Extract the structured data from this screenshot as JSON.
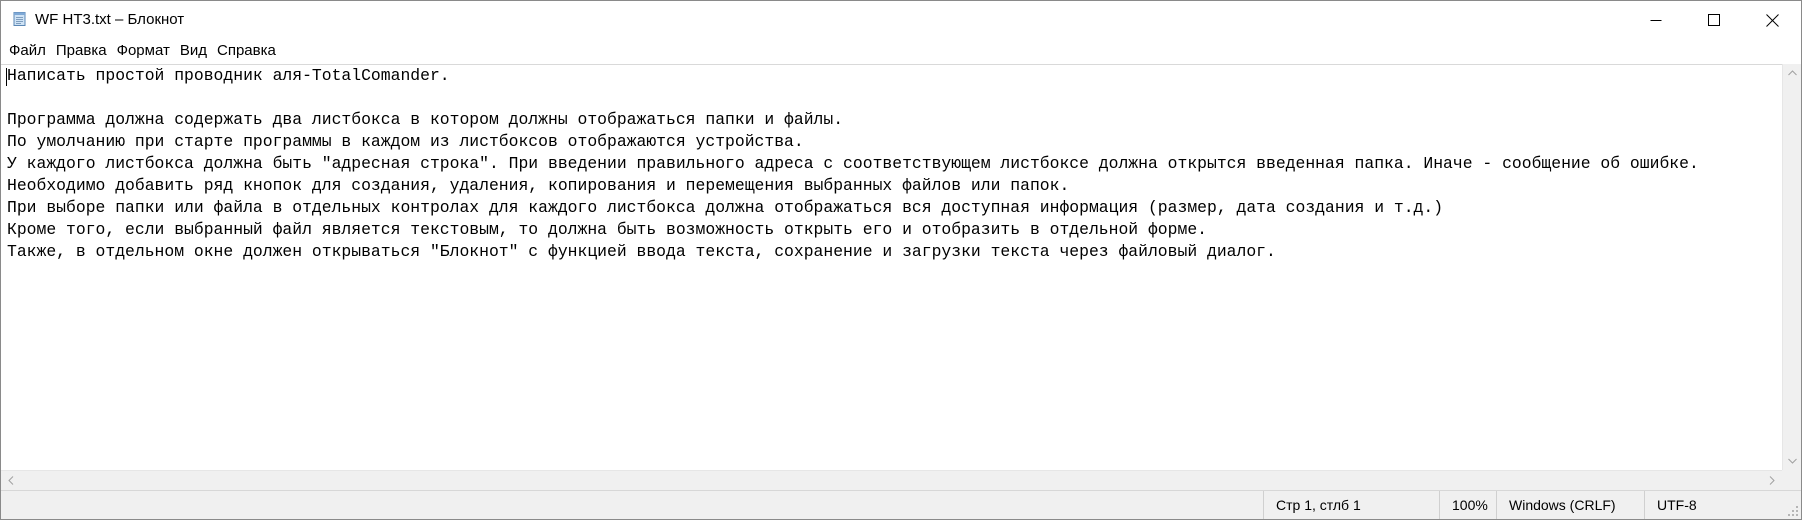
{
  "window": {
    "title": "WF HT3.txt – Блокнот",
    "app_icon": "notepad-icon",
    "controls": {
      "minimize_icon": "minimize-icon",
      "maximize_icon": "maximize-icon",
      "close_icon": "close-icon"
    }
  },
  "menubar": {
    "items": [
      {
        "label": "Файл"
      },
      {
        "label": "Правка"
      },
      {
        "label": "Формат"
      },
      {
        "label": "Вид"
      },
      {
        "label": "Справка"
      }
    ]
  },
  "editor": {
    "lines": [
      "Написать простой проводник аля-TotalComander.",
      "",
      "Программа должна содержать два листбокса в котором должны отображаться папки и файлы.",
      "По умолчанию при старте программы в каждом из листбоксов отображаются устройства.",
      "У каждого листбокса должна быть \"адресная строка\". При введении правильного адреса с соответствующем листбоксе должна открытся введенная папка. Иначе - сообщение об ошибке.",
      "Необходимо добавить ряд кнопок для создания, удаления, копирования и перемещения выбранных файлов или папок.",
      "При выборе папки или файла в отдельных контролах для каждого листбокса должна отображаться вся доступная информация (размер, дата создания и т.д.)",
      "Кроме того, если выбранный файл является текстовым, то должна быть возможность открыть его и отобразить в отдельной форме.",
      "Также, в отдельном окне должен открываться \"Блокнот\" с функцией ввода текста, сохранение и загрузки текста через файловый диалог."
    ]
  },
  "statusbar": {
    "position": "Стр 1, стлб 1",
    "zoom": "100%",
    "line_endings": "Windows (CRLF)",
    "encoding": "UTF-8"
  },
  "colors": {
    "chrome": "#f0f0f0",
    "border": "#8a8a8a",
    "text": "#000000"
  }
}
